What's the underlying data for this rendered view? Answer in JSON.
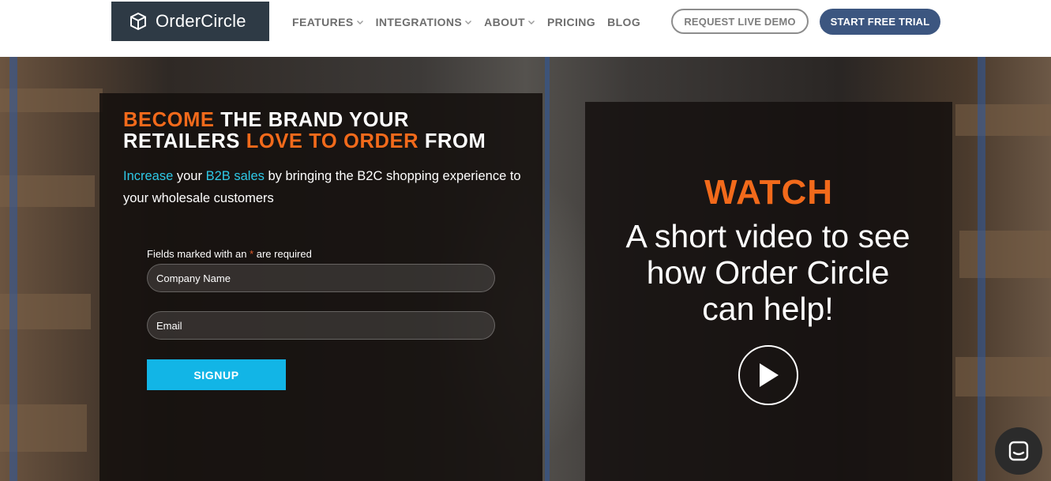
{
  "brand": {
    "name": "OrderCircle"
  },
  "nav": {
    "items": [
      {
        "label": "FEATURES",
        "dropdown": true
      },
      {
        "label": "INTEGRATIONS",
        "dropdown": true
      },
      {
        "label": "ABOUT",
        "dropdown": true
      },
      {
        "label": "PRICING",
        "dropdown": false
      },
      {
        "label": "BLOG",
        "dropdown": false
      }
    ],
    "demo_label": "REQUEST LIVE DEMO",
    "trial_label": "START FREE TRIAL"
  },
  "hero": {
    "headline": {
      "part1": "BECOME",
      "part2": " THE BRAND YOUR",
      "part3": "RETAILERS ",
      "part4": "LOVE TO ORDER",
      "part5": " FROM"
    },
    "subhead": {
      "part1": "Increase",
      "part2": " your ",
      "part3": "B2B sales",
      "part4": " by bringing the B2C shopping experience to your wholesale customers"
    },
    "form": {
      "note_prefix": "Fields marked with an ",
      "note_asterisk": "*",
      "note_suffix": " are required",
      "company_placeholder": "Company Name",
      "email_placeholder": "Email",
      "submit_label": "SIGNUP"
    },
    "video": {
      "watch": "WATCH",
      "description": "A short video to see how Order Circle can help!"
    }
  },
  "colors": {
    "accent_orange": "#f26a1b",
    "accent_cyan": "#2ec8e6",
    "trial_button": "#3c5680",
    "signup_button": "#12b5e6",
    "logo_bg": "#2e3a45"
  },
  "icons": {
    "logo": "box-icon",
    "nav_dropdown": "chevron-down-icon",
    "video": "play-icon",
    "chat": "chat-icon"
  }
}
